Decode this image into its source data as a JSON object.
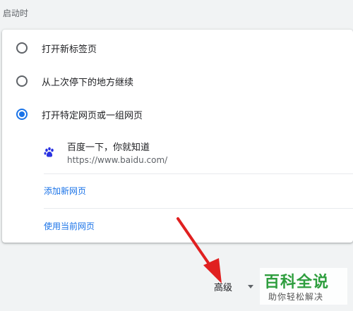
{
  "section": {
    "title": "启动时"
  },
  "startup_options": [
    {
      "label": "打开新标签页",
      "checked": false
    },
    {
      "label": "从上次停下的地方继续",
      "checked": false
    },
    {
      "label": "打开特定网页或一组网页",
      "checked": true
    }
  ],
  "pages": [
    {
      "title": "百度一下，你就知道",
      "url": "https://www.baidu.com/",
      "icon": "baidu-paw-icon"
    }
  ],
  "actions": {
    "add_page": "添加新网页",
    "use_current": "使用当前网页"
  },
  "advanced": {
    "label": "高级"
  },
  "watermark": {
    "logo": "百科全说",
    "subtitle": "助你轻松解决"
  },
  "colors": {
    "accent": "#1a73e8",
    "annotation_arrow": "#e02020",
    "watermark_green": "#2e9e3e"
  }
}
